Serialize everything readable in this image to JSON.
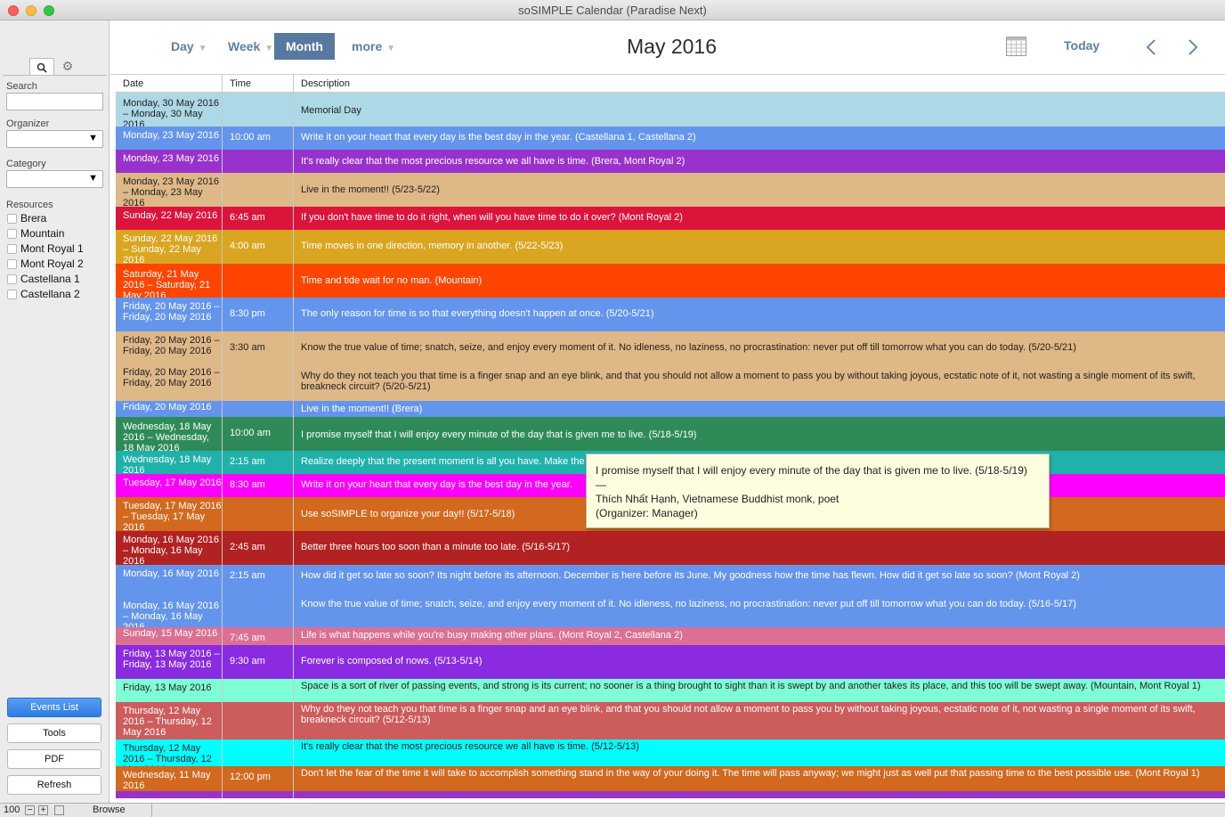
{
  "window": {
    "title": "soSIMPLE Calendar (Paradise Next)"
  },
  "sidebar": {
    "search_label": "Search",
    "organizer_label": "Organizer",
    "category_label": "Category",
    "resources_label": "Resources",
    "resources": [
      "Brera",
      "Mountain",
      "Mont Royal 1",
      "Mont Royal 2",
      "Castellana 1",
      "Castellana 2"
    ],
    "buttons": {
      "events_list": "Events List",
      "tools": "Tools",
      "pdf": "PDF",
      "refresh": "Refresh"
    }
  },
  "toolbar": {
    "day": "Day",
    "week": "Week",
    "month": "Month",
    "more": "more",
    "title": "May 2016",
    "today": "Today",
    "prev_icon": "chevron-left-icon",
    "next_icon": "chevron-right-icon",
    "calendar_icon": "calendar-grid-icon"
  },
  "grid": {
    "headers": {
      "date": "Date",
      "time": "Time",
      "description": "Description"
    }
  },
  "rows": [
    {
      "date": "Monday, 30 May 2016 – Monday, 30 May 2016",
      "time": "",
      "desc": "Memorial Day",
      "color": "#add8e6"
    },
    {
      "date": "Monday, 23 May 2016",
      "time": "10:00 am",
      "desc": "Write it on your heart that every day is the best day in the year. (Castellana 1, Castellana 2)",
      "color": "#6495ed"
    },
    {
      "date": "Monday, 23 May 2016",
      "time": "",
      "desc": "It's really clear that the most precious resource we all have is time. (Brera, Mont Royal 2)",
      "color": "#9932cc"
    },
    {
      "date": "Monday, 23 May 2016 – Monday, 23 May 2016",
      "time": "",
      "desc": "Live in the moment!! (5/23-5/22)",
      "color": "#deb887"
    },
    {
      "date": "Sunday, 22 May 2016",
      "time": "6:45 am",
      "desc": "If you don't have time to do it right, when will you have time to do it over? (Mont Royal 2)",
      "color": "#dc143c"
    },
    {
      "date": "Sunday, 22 May 2016 – Sunday, 22 May 2016",
      "time": "4:00 am",
      "desc": "Time moves in one direction, memory in another. (5/22-5/23)",
      "color": "#daa520"
    },
    {
      "date": "Saturday, 21 May 2016 – Saturday, 21 May 2016",
      "time": "",
      "desc": "Time and tide wait for no man. (Mountain)",
      "color": "#ff4500"
    },
    {
      "date": "Friday, 20 May 2016 – Friday, 20 May 2016",
      "time": "8:30 pm",
      "desc": "The only reason for time is so that everything doesn't happen at once. (5/20-5/21)",
      "color": "#6495ed"
    },
    {
      "date": "Friday, 20 May 2016 – Friday, 20 May 2016",
      "time": "3:30 am",
      "desc": "Know the true value of time; snatch, seize, and enjoy every moment of it. No idleness, no laziness, no procrastination: never put off till tomorrow what you can do today. (5/20-5/21)",
      "date2": "Friday, 20 May 2016 – Friday, 20 May 2016",
      "desc2": "Why do they not teach you that time is a finger snap and an eye blink, and that you should not allow a moment to pass you by without taking joyous, ecstatic note of it, not wasting a single moment of its swift, breakneck circuit? (5/20-5/21)",
      "color": "#deb887"
    },
    {
      "date": "Friday, 20 May 2016",
      "time": "",
      "desc": "Live in the moment!! (Brera)",
      "color": "#6495ed"
    },
    {
      "date": "Wednesday, 18 May 2016 – Wednesday, 18 May 2016",
      "time": "10:00 am",
      "desc": "I promise myself that I will enjoy every minute of the day that is given me to live. (5/18-5/19)",
      "color": "#2e8b57"
    },
    {
      "date": "Wednesday, 18 May 2016",
      "time": "2:15 am",
      "desc": "Realize deeply that the present moment is all you have. Make the",
      "color": "#20b2aa"
    },
    {
      "date": "Tuesday, 17 May 2016",
      "time": "8:30 am",
      "desc": "Write it on your heart that every day is the best day in the year.",
      "color": "#ff00ff"
    },
    {
      "date": "Tuesday, 17 May 2016 – Tuesday, 17 May 2016",
      "time": "",
      "desc": "Use soSIMPLE to organize your day!! (5/17-5/18)",
      "color": "#d2691e"
    },
    {
      "date": "Monday, 16 May 2016 – Monday, 16 May 2016",
      "time": "2:45 am",
      "desc": "Better three hours too soon than a minute too late. (5/16-5/17)",
      "color": "#b22222"
    },
    {
      "date": "Monday, 16 May 2016",
      "time": "2:15 am",
      "desc": "How did it get so late so soon? Its night before its afternoon. December is here before its June. My goodness how the time has flewn. How did it get so late so soon? (Mont Royal 2)",
      "date2": "Monday, 16 May 2016 – Monday, 16 May 2016",
      "desc2": "Know the true value of time; snatch, seize, and enjoy every moment of it. No idleness, no laziness, no procrastination: never put off till tomorrow what you can do today. (5/16-5/17)",
      "color": "#6495ed"
    },
    {
      "date": "Sunday, 15 May 2016",
      "time": "7:45 am",
      "desc": "Life is what happens while you're busy making other plans. (Mont Royal 2, Castellana 2)",
      "color": "#db7093"
    },
    {
      "date": "Friday, 13 May 2016 – Friday, 13 May 2016",
      "time": "9:30 am",
      "desc": "Forever is composed of nows. (5/13-5/14)",
      "color": "#8a2be2"
    },
    {
      "date": "Friday, 13 May 2016",
      "time": "",
      "desc": "Space is a sort of river of passing events, and strong is its current; no sooner is a thing brought to sight than it is swept by and another takes its place, and this too will be swept away. (Mountain, Mont Royal 1)",
      "color": "#7fffd4"
    },
    {
      "date": "Thursday, 12 May 2016 – Thursday, 12 May 2016",
      "time": "",
      "desc": "Why do they not teach you that time is a finger snap and an eye blink, and that you should not allow a moment to pass you by without taking joyous, ecstatic note of it, not wasting a single moment of its swift, breakneck circuit? (5/12-5/13)",
      "color": "#cd5c5c"
    },
    {
      "date": "Thursday, 12 May 2016 – Thursday, 12 May 2016",
      "time": "",
      "desc": "It's really clear that the most precious resource we all have is time. (5/12-5/13)",
      "color": "#00ffff"
    },
    {
      "date": "Wednesday, 11 May 2016",
      "time": "12:00 pm",
      "desc": "Don't let the fear of the time it will take to accomplish something stand in the way of your doing it. The time will pass anyway; we might just as well put that passing time to the best possible use. (Mont Royal 1)",
      "color": "#d2691e"
    },
    {
      "date": "",
      "time": "",
      "desc": "",
      "color": "#9932cc"
    }
  ],
  "tooltip": {
    "line1": "I promise myself that I will enjoy every minute of the day that is given me to live. (5/18-5/19)",
    "line2": "—",
    "line3": "Thích Nhất Hạnh, Vietnamese Buddhist monk, poet",
    "line4": "(Organizer: Manager)"
  },
  "statusbar": {
    "zoom": "100",
    "mode": "Browse"
  }
}
